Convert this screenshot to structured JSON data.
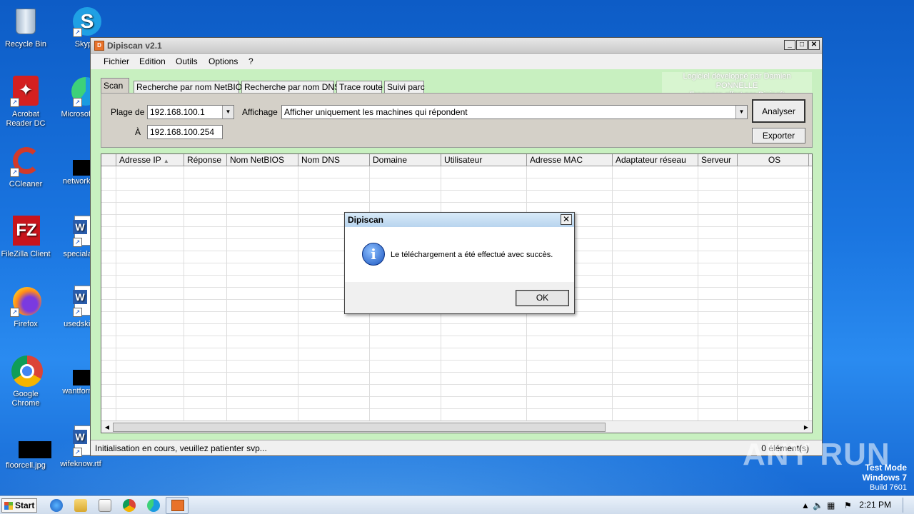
{
  "desktop": {
    "icons": [
      {
        "label": "Recycle Bin"
      },
      {
        "label": "Skype"
      },
      {
        "label": "Acrobat Reader DC"
      },
      {
        "label": "Microsoft E"
      },
      {
        "label": "CCleaner"
      },
      {
        "label": "networksa"
      },
      {
        "label": "FileZilla Client"
      },
      {
        "label": "specialact"
      },
      {
        "label": "Firefox"
      },
      {
        "label": "usedskills"
      },
      {
        "label": "Google Chrome"
      },
      {
        "label": "wantforme"
      },
      {
        "label": "floorcell.jpg"
      },
      {
        "label": "wifeknow.rtf"
      }
    ],
    "watermark": {
      "line1": "Test Mode",
      "line2": "Windows 7",
      "line3": "Build 7601"
    },
    "anyrun": "ANY RUN"
  },
  "window": {
    "title": "Dipiscan v2.1",
    "menu": [
      "Fichier",
      "Edition",
      "Outils",
      "Options",
      "?"
    ],
    "tabs": [
      "Scan",
      "Recherche par nom NetBIOS",
      "Recherche par nom DNS",
      "Trace route",
      "Suivi parc"
    ],
    "credit1": "Logiciel développé par Damien PONNELLE",
    "credit2": "Freeware offert par Dipisoft",
    "plage_label": "Plage de",
    "plage_value": "192.168.100.1",
    "a_label": "À",
    "a_value": "192.168.100.254",
    "affichage_label": "Affichage",
    "affichage_value": "Afficher uniquement les machines qui répondent",
    "analyser": "Analyser",
    "exporter": "Exporter",
    "columns": [
      "Adresse IP",
      "Réponse",
      "Nom NetBIOS",
      "Nom DNS",
      "Domaine",
      "Utilisateur",
      "Adresse MAC",
      "Adaptateur réseau",
      "Serveur",
      "OS"
    ],
    "status_left": "Initialisation en cours, veuillez patienter svp...",
    "status_right": "0 élément(s)"
  },
  "dialog": {
    "title": "Dipiscan",
    "message": "Le téléchargement a été effectué avec succès.",
    "ok": "OK"
  },
  "taskbar": {
    "start": "Start",
    "clock": "2:21 PM"
  }
}
